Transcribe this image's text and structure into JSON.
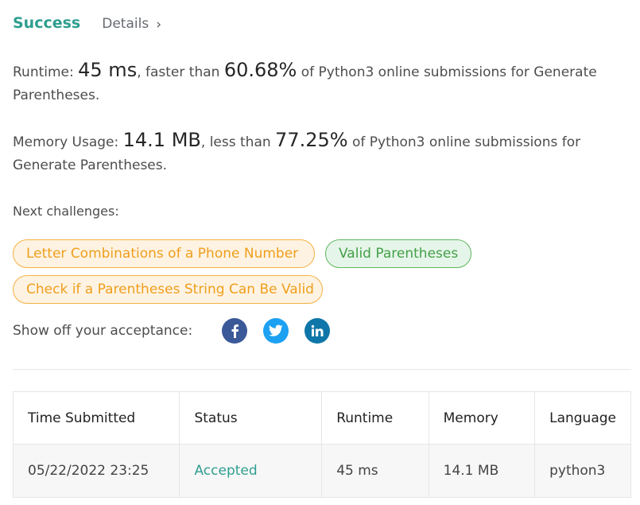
{
  "header": {
    "status": "Success",
    "details_label": "Details",
    "details_chevron": "›"
  },
  "runtime": {
    "label": "Runtime: ",
    "value": "45 ms",
    "comparison": ", faster than ",
    "percent": "60.68%",
    "suffix": " of Python3 online submissions for Generate Parentheses."
  },
  "memory": {
    "label": "Memory Usage: ",
    "value": "14.1 MB",
    "comparison": ", less than ",
    "percent": "77.25%",
    "suffix": " of Python3 online submissions for Generate Parentheses."
  },
  "next_challenges": {
    "label": "Next challenges:",
    "items": [
      {
        "title": "Letter Combinations of a Phone Number",
        "difficulty": "medium"
      },
      {
        "title": "Valid Parentheses",
        "difficulty": "easy"
      },
      {
        "title": "Check if a Parentheses String Can Be Valid",
        "difficulty": "medium"
      }
    ]
  },
  "share": {
    "label": "Show off your acceptance:",
    "icons": [
      "facebook-icon",
      "twitter-icon",
      "linkedin-icon"
    ]
  },
  "submissions_table": {
    "columns": [
      "Time Submitted",
      "Status",
      "Runtime",
      "Memory",
      "Language"
    ],
    "rows": [
      {
        "time_submitted": "05/22/2022 23:25",
        "status": "Accepted",
        "runtime": "45 ms",
        "memory": "14.1 MB",
        "language": "python3"
      }
    ]
  },
  "colors": {
    "success": "#2e9e8f",
    "medium_tag_text": "#ef9e1c",
    "medium_tag_border": "#f5b041",
    "easy_tag_text": "#43a047",
    "easy_tag_border": "#5cb85c",
    "facebook": "#3b5998",
    "twitter": "#1da1f2",
    "linkedin": "#0e76a8"
  }
}
